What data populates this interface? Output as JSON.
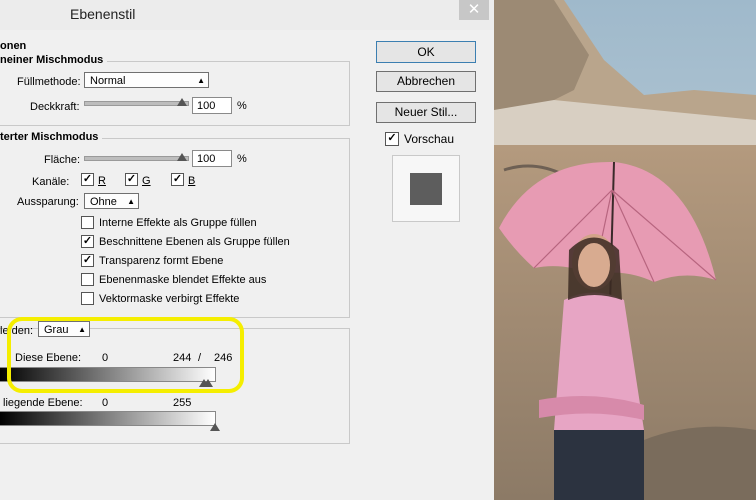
{
  "window": {
    "title": "Ebenenstil",
    "close_glyph": "✕"
  },
  "sections": {
    "options": "onen",
    "general_blend": "neiner Mischmodus",
    "advanced_blend": "terter Mischmodus"
  },
  "general": {
    "fill_method_label": "Füllmethode:",
    "fill_method_value": "Normal",
    "opacity_label": "Deckkraft:",
    "opacity_value": "100",
    "opacity_unit": "%"
  },
  "advanced": {
    "fill_label": "Fläche:",
    "fill_value": "100",
    "fill_unit": "%",
    "channels_label": "Kanäle:",
    "channels": [
      {
        "label": "R",
        "checked": true
      },
      {
        "label": "G",
        "checked": true
      },
      {
        "label": "B",
        "checked": true
      }
    ],
    "knockout_label": "Aussparung:",
    "knockout_value": "Ohne",
    "options": [
      {
        "label": "Interne Effekte als Gruppe füllen",
        "checked": false
      },
      {
        "label": "Beschnittene Ebenen als Gruppe füllen",
        "checked": true
      },
      {
        "label": "Transparenz formt Ebene",
        "checked": true
      },
      {
        "label": "Ebenenmaske blendet Effekte aus",
        "checked": false
      },
      {
        "label": "Vektormaske verbirgt Effekte",
        "checked": false
      }
    ]
  },
  "blend_if": {
    "label": "le den:",
    "channel_value": "Grau",
    "this_layer_label": "Diese Ebene:",
    "this_layer_low": "0",
    "this_layer_high_a": "244",
    "this_layer_sep": "/",
    "this_layer_high_b": "246",
    "underlying_label": "liegende Ebene:",
    "underlying_low": "0",
    "underlying_high": "255"
  },
  "buttons": {
    "ok": "OK",
    "cancel": "Abbrechen",
    "new_style": "Neuer Stil...",
    "preview_label": "Vorschau",
    "preview_checked": true
  },
  "colors": {
    "highlight": "#f5ee00",
    "dialog_bg": "#f0f0f0"
  }
}
